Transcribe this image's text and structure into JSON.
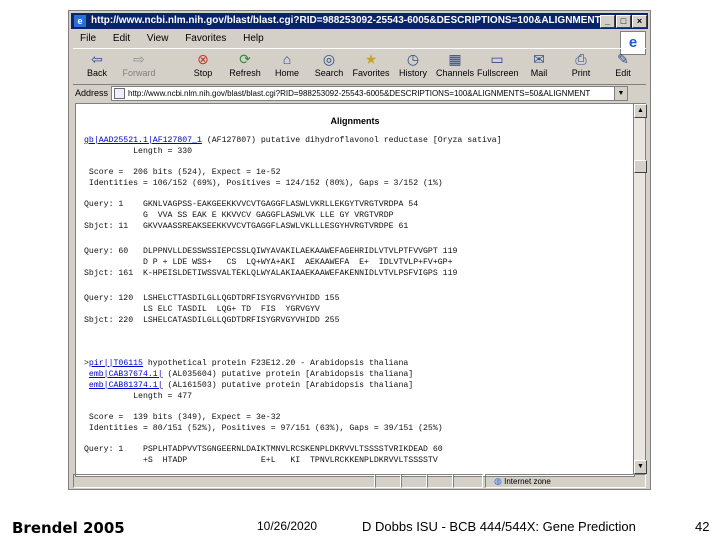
{
  "window": {
    "title": "http://www.ncbi.nlm.nih.gov/blast/blast.cgi?RID=988253092-25543-6005&DESCRIPTIONS=100&ALIGNMENT - Microsoft Internet Explorer",
    "controls": [
      "_",
      "□",
      "×"
    ]
  },
  "menu": [
    "File",
    "Edit",
    "View",
    "Favorites",
    "Help"
  ],
  "toolbar": {
    "back": "Back",
    "forward": "Forward",
    "stop": "Stop",
    "refresh": "Refresh",
    "home": "Home",
    "search": "Search",
    "favorites": "Favorites",
    "history": "History",
    "channels": "Channels",
    "fullscreen": "Fullscreen",
    "mail": "Mail",
    "print": "Print",
    "edit": "Edit"
  },
  "address": {
    "label": "Address",
    "url": "http://www.ncbi.nlm.nih.gov/blast/blast.cgi?RID=988253092-25543-6005&DESCRIPTIONS=100&ALIGNMENTS=50&ALIGNMENT"
  },
  "content": {
    "heading": "Alignments",
    "hit1": {
      "id": "gb|AAD25521.1|AF127807_1",
      "desc": " (AF127807) putative dihydroflavonol reductase [Oryza sativa]",
      "length": "          Length = 330",
      "score": " Score =  206 bits (524), Expect = 1e-52",
      "identities": " Identities = 106/152 (69%), Positives = 124/152 (80%), Gaps = 3/152 (1%)",
      "q1": "Query: 1    GKNLVAGPSS-EAKGEEKKVVCVTGAGGFLASWLVKRLLEKGYTVRGTVRDPA 54",
      "m1": "            G  VVA SS EAK E KKVVCV GAGGFLASWLVK LLE GY VRGTVRDP",
      "s1": "Sbjct: 11   GKVVAASSREAKSEEKKVVCVTGAGGFLASWLVKLLLESGYHVRGTVRDPE 61",
      "q2": "Query: 60   DLPPNVLLDESSWSSIEPCSSLQIWYAVAKILAEKAAWEFAGEHRIDLVTVLPTFVVGPT 119",
      "m2": "            D P + LDE WSS+   CS  LQ+WYA+AKI  AEKAAWEFA  E+  IDLVTVLP+FV+GP+",
      "s2": "Sbjct: 161  K-HPEISLDETIWSSVALTEKLQLWYALAKIAAEKAAWEFAKENNIDLVTVLPSFVIGPS 119",
      "q3": "Query: 120  LSHELCTTASDILGLLQGDTDRFISYGRVGYVHIDD 155",
      "m3": "            LS ELC TASDIL  LQG+ TD  FIS  YGRVGYV",
      "s3": "Sbjct: 220  LSHELCATASDILGLLQGDTDRFISYGRVGYVHIDD 255"
    },
    "hit2": {
      "id": "pir||T06115",
      "desc": " hypothetical protein F23E12.20 - Arabidopsis thaliana",
      "alt1_id": "emb|CAB37674.1|",
      "alt1_desc": " (AL035604) putative protein [Arabidopsis thaliana]",
      "alt2_id": "emb|CAB81374.1|",
      "alt2_desc": " (AL161503) putative protein [Arabidopsis thaliana]",
      "length": "          Length = 477",
      "score": " Score =  139 bits (349), Expect = 3e-32",
      "identities": " Identities = 80/151 (52%), Positives = 97/151 (63%), Gaps = 39/151 (25%)",
      "q1": "Query: 1    PSPLHTADPVVTSGNGEERNLDAIKTMNVLRCSKENPLDKRVVLTSSSSTVRIKDEAD 60",
      "m1": "            +S  HTADP               E+L   KI  TPNVLRCKKENPLDKRVVLTSSSSTV"
    },
    "footer": {
      "author": "Brendel 2005",
      "date": "10/26/2020",
      "course": "D Dobbs ISU - BCB 444/544X: Gene Prediction",
      "page": "42"
    }
  },
  "status": {
    "zone": "Internet zone"
  },
  "colors": {
    "titlebar": "#0a246a",
    "chrome": "#d4d0c8",
    "link": "#0000cc"
  }
}
